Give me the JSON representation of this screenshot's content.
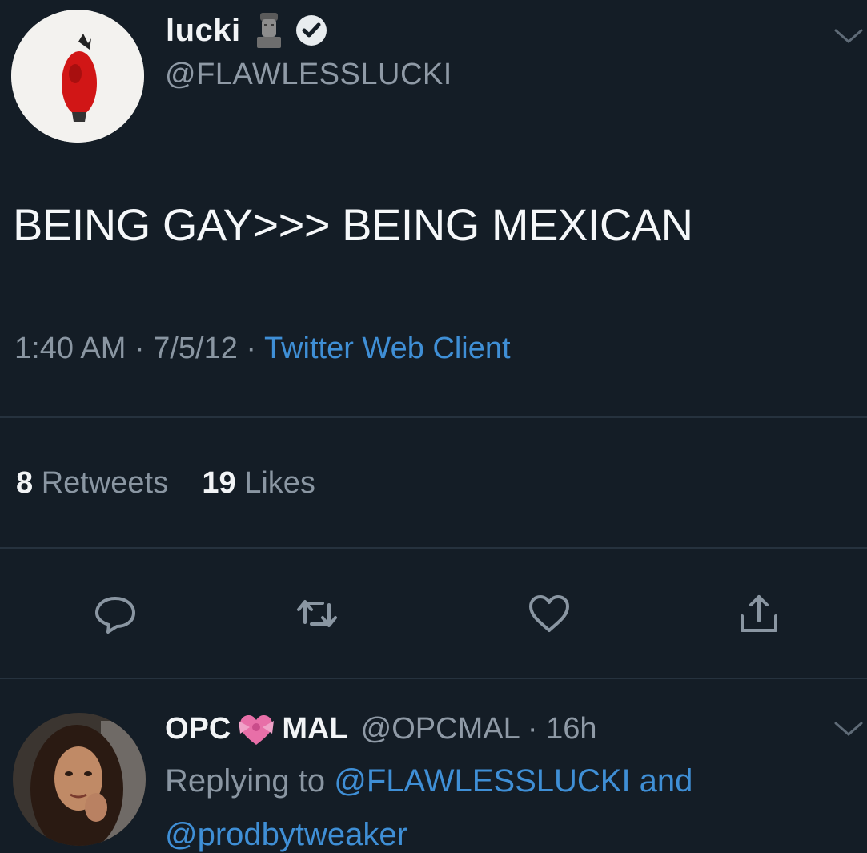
{
  "tweet": {
    "display_name": "lucki",
    "handle": "@FLAWLESSLUCKI",
    "text": "BEING GAY>>> BEING MEXICAN",
    "time": "1:40 AM",
    "sep1": " · ",
    "date": "7/5/12",
    "sep2": " · ",
    "client": "Twitter Web Client",
    "retweet_count": "8",
    "retweet_label": "Retweets",
    "like_count": "19",
    "like_label": "Likes"
  },
  "reply": {
    "name_part1": "OPC",
    "name_part2": "MAL",
    "handle_time": "@OPCMAL · 16h",
    "replying_prefix": "Replying to ",
    "replying_mention1": "@FLAWLESSLUCKI and",
    "replying_mention2": "@prodbytweaker"
  },
  "icons": {
    "statue": "moai-statue-emoji",
    "verified": "verified-badge-icon",
    "reply": "reply-icon",
    "retweet": "retweet-icon",
    "like": "heart-icon",
    "share": "share-icon",
    "chevron": "chevron-down-icon",
    "heart_emoji": "heart-with-ribbon-emoji"
  },
  "colors": {
    "background": "#141d26",
    "link": "#3f8fd6",
    "muted": "#8a96a2"
  }
}
